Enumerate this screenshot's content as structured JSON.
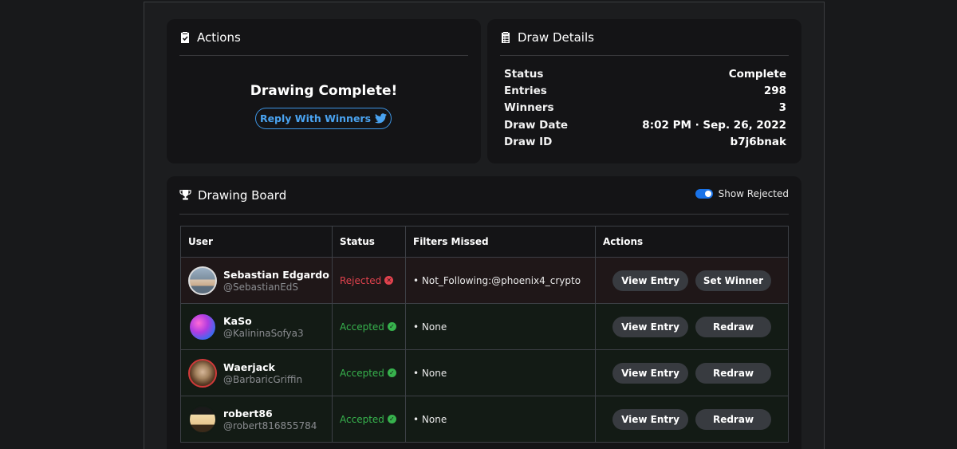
{
  "actions": {
    "title": "Actions",
    "message": "Drawing Complete!",
    "reply_label": "Reply With Winners"
  },
  "details": {
    "title": "Draw Details",
    "rows": [
      {
        "label": "Status",
        "value": "Complete"
      },
      {
        "label": "Entries",
        "value": "298"
      },
      {
        "label": "Winners",
        "value": "3"
      },
      {
        "label": "Draw Date",
        "value": "8:02 PM · Sep. 26, 2022"
      },
      {
        "label": "Draw ID",
        "value": "b7j6bnak"
      }
    ]
  },
  "board": {
    "title": "Drawing Board",
    "toggle_label": "Show Rejected",
    "toggle_on": true,
    "columns": [
      "User",
      "Status",
      "Filters Missed",
      "Actions"
    ],
    "rows": [
      {
        "name": "Sebastian Edgardo",
        "handle": "@SebastianEdS",
        "status": "Rejected",
        "filter": "• Not_Following:@phoenix4_crypto",
        "btn1": "View Entry",
        "btn2": "Set Winner"
      },
      {
        "name": "KaSo",
        "handle": "@KalininaSofya3",
        "status": "Accepted",
        "filter": "• None",
        "btn1": "View Entry",
        "btn2": "Redraw"
      },
      {
        "name": "Waerjack",
        "handle": "@BarbaricGriffin",
        "status": "Accepted",
        "filter": "• None",
        "btn1": "View Entry",
        "btn2": "Redraw"
      },
      {
        "name": "robert86",
        "handle": "@robert816855784",
        "status": "Accepted",
        "filter": "• None",
        "btn1": "View Entry",
        "btn2": "Redraw"
      }
    ]
  },
  "colors": {
    "accent": "#1a73e8",
    "twitter": "#4aa3f0",
    "rejected": "#e0424d",
    "accepted": "#37b24d"
  },
  "icons": {
    "actions": "clipboard-check-icon",
    "details": "clipboard-list-icon",
    "board": "trophy-icon",
    "reply": "twitter-icon"
  }
}
